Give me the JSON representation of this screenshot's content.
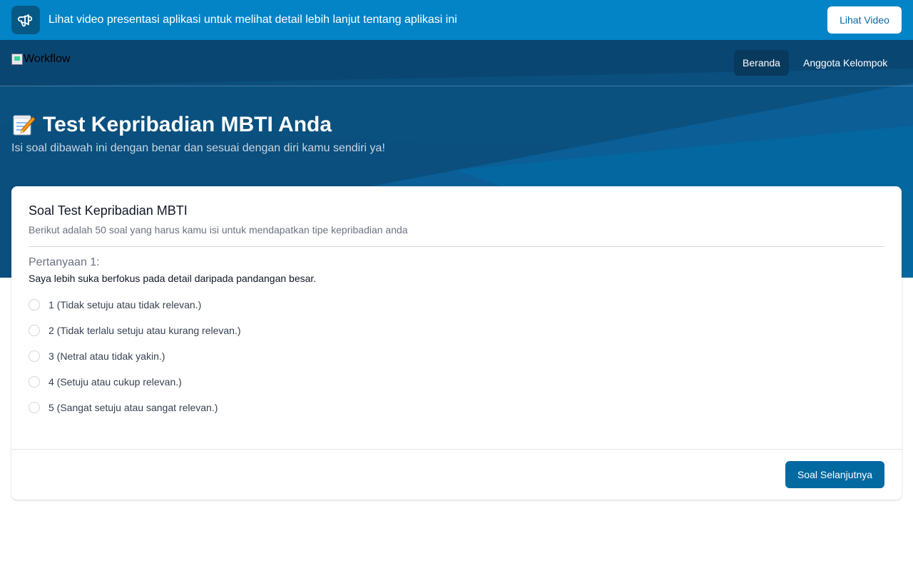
{
  "banner": {
    "icon": "megaphone-icon",
    "text": "Lihat video presentasi aplikasi untuk melihat detail lebih lanjut tentang aplikasi ini",
    "button_label": "Lihat Video"
  },
  "nav": {
    "logo_alt": "Workflow",
    "items": [
      {
        "label": "Beranda",
        "active": true
      },
      {
        "label": "Anggota Kelompok",
        "active": false
      }
    ]
  },
  "hero": {
    "title_icon": "memo-icon",
    "title": "Test Kepribadian MBTI Anda",
    "subtitle": "Isi soal dibawah ini dengan benar dan sesuai dengan diri kamu sendiri ya!"
  },
  "card": {
    "title": "Soal Test Kepribadian MBTI",
    "description": "Berikut adalah 50 soal yang harus kamu isi untuk mendapatkan tipe kepribadian anda",
    "question_label": "Pertanyaan 1:",
    "question_text": "Saya lebih suka berfokus pada detail daripada pandangan besar.",
    "options": [
      {
        "label": "1 (Tidak setuju atau tidak relevan.)",
        "checked": false
      },
      {
        "label": "2 (Tidak terlalu setuju atau kurang relevan.)",
        "checked": false
      },
      {
        "label": "3 (Netral atau tidak yakin.)",
        "checked": false
      },
      {
        "label": "4 (Setuju atau cukup relevan.)",
        "checked": false
      },
      {
        "label": "5 (Sangat setuju atau sangat relevan.)",
        "checked": false
      }
    ],
    "next_button_label": "Soal Selanjutnya"
  },
  "colors": {
    "banner": "#0284c7",
    "hero": "#0a4f7e",
    "nav_active": "#083a5e",
    "primary_button": "#0369a1"
  }
}
